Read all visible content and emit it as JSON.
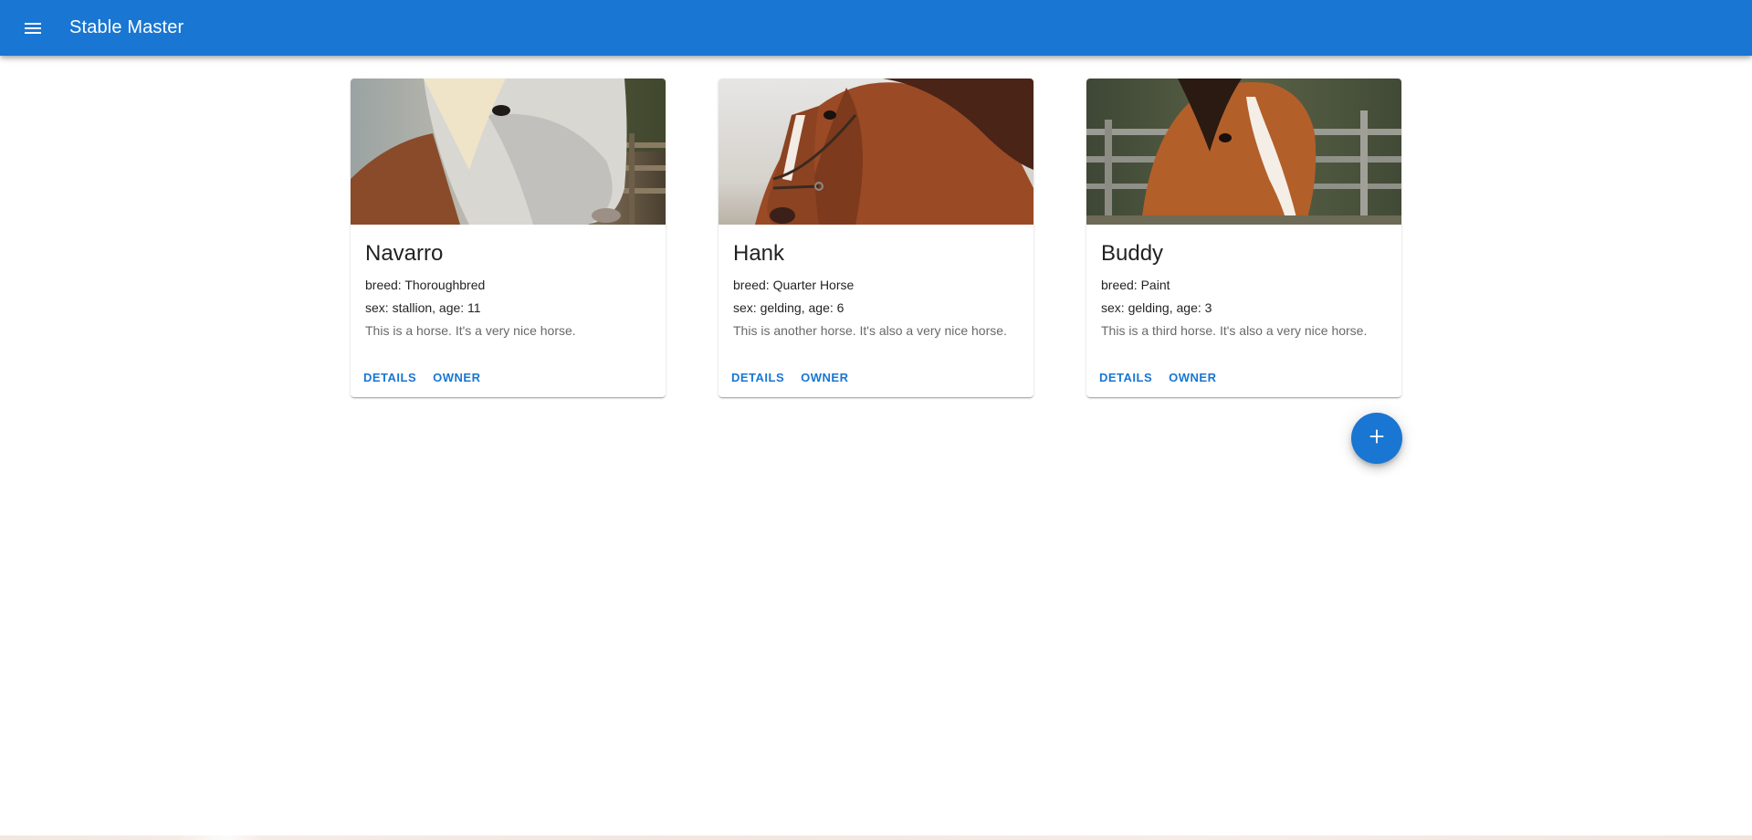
{
  "app": {
    "title": "Stable Master",
    "menu_icon": "hamburger-menu-icon"
  },
  "horses": [
    {
      "name": "Navarro",
      "breed_label": "breed: Thoroughbred",
      "sex_age_label": "sex: stallion,  age: 11",
      "description": "This is a horse. It's a very nice horse.",
      "details_label": "DETAILS",
      "owner_label": "OWNER",
      "photo": "grey-white-horse-photo"
    },
    {
      "name": "Hank",
      "breed_label": "breed: Quarter Horse",
      "sex_age_label": "sex: gelding,  age: 6",
      "description": "This is another horse. It's also a very nice horse.",
      "details_label": "DETAILS",
      "owner_label": "OWNER",
      "photo": "chestnut-horse-halter-photo"
    },
    {
      "name": "Buddy",
      "breed_label": "breed: Paint",
      "sex_age_label": "sex: gelding,  age: 3",
      "description": "This is a third horse. It's also a very nice horse.",
      "details_label": "DETAILS",
      "owner_label": "OWNER",
      "photo": "bay-horse-fence-photo"
    }
  ],
  "fab": {
    "icon": "plus-icon"
  },
  "colors": {
    "primary": "#1976d2",
    "background": "#ffffff"
  }
}
